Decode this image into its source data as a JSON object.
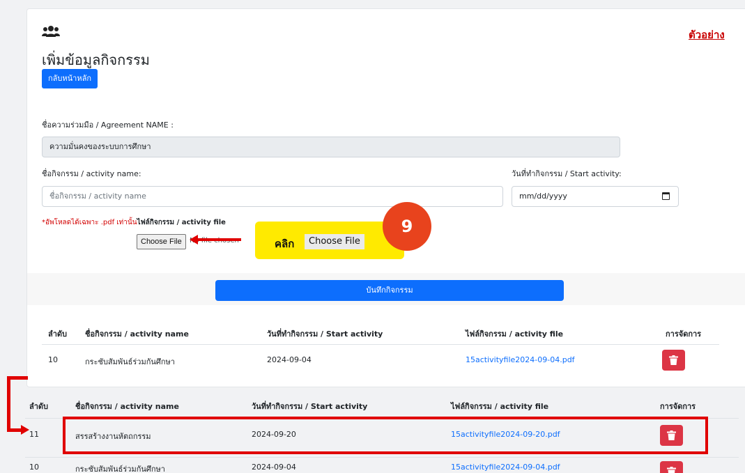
{
  "header": {
    "icon": "users-icon",
    "title": "เพิ่มข้อมูลกิจกรรม",
    "example_link": "ตัวอย่าง",
    "home_button": "กลับหน้าหลัก"
  },
  "form": {
    "agreement_label": "ชื่อความร่วมมือ / Agreement NAME :",
    "agreement_value": "ความมั่นคงของระบบการศึกษา",
    "activity_name_label": "ชื่อกิจกรรม / activity name:",
    "activity_name_placeholder": "ชื่อกิจกรรม / activity name",
    "start_label": "วันที่ทำกิจกรรม / Start activity:",
    "start_placeholder": "mm/dd/yyyy",
    "upload_note_red": "*อัพโหลดได้เฉพาะ .pdf เท่านั้น",
    "upload_note_bold": "ไฟล์กิจกรรม / activity file",
    "choose_file": "Choose File",
    "no_file": "No file chosen",
    "save_button": "บันทึกกิจกรรม"
  },
  "callout": {
    "click_text": "คลิก",
    "choose_text": "Choose File",
    "step": "9"
  },
  "table": {
    "columns": [
      "ลำดับ",
      "ชื่อกิจกรรม / activity name",
      "วันที่ทำกิจกรรม / Start activity",
      "ไฟล์กิจกรรม / activity file",
      "การจัดการ"
    ],
    "rows_before": [
      [
        "10",
        "กระชับสัมพันธ์ร่วมกันศึกษา",
        "2024-09-04",
        "15activityfile2024-09-04.pdf"
      ]
    ],
    "rows_after": [
      [
        "11",
        "สรรสร้างงานหัตถกรรม",
        "2024-09-20",
        "15activityfile2024-09-20.pdf"
      ],
      [
        "10",
        "กระชับสัมพันธ์ร่วมกันศึกษา",
        "2024-09-04",
        "15activityfile2024-09-04.pdf"
      ]
    ]
  },
  "colors": {
    "primary": "#0d6efd",
    "danger": "#dc3545",
    "annotation_red": "#e00000",
    "callout_yellow": "#ffea00",
    "badge_orange": "#e8431d"
  }
}
